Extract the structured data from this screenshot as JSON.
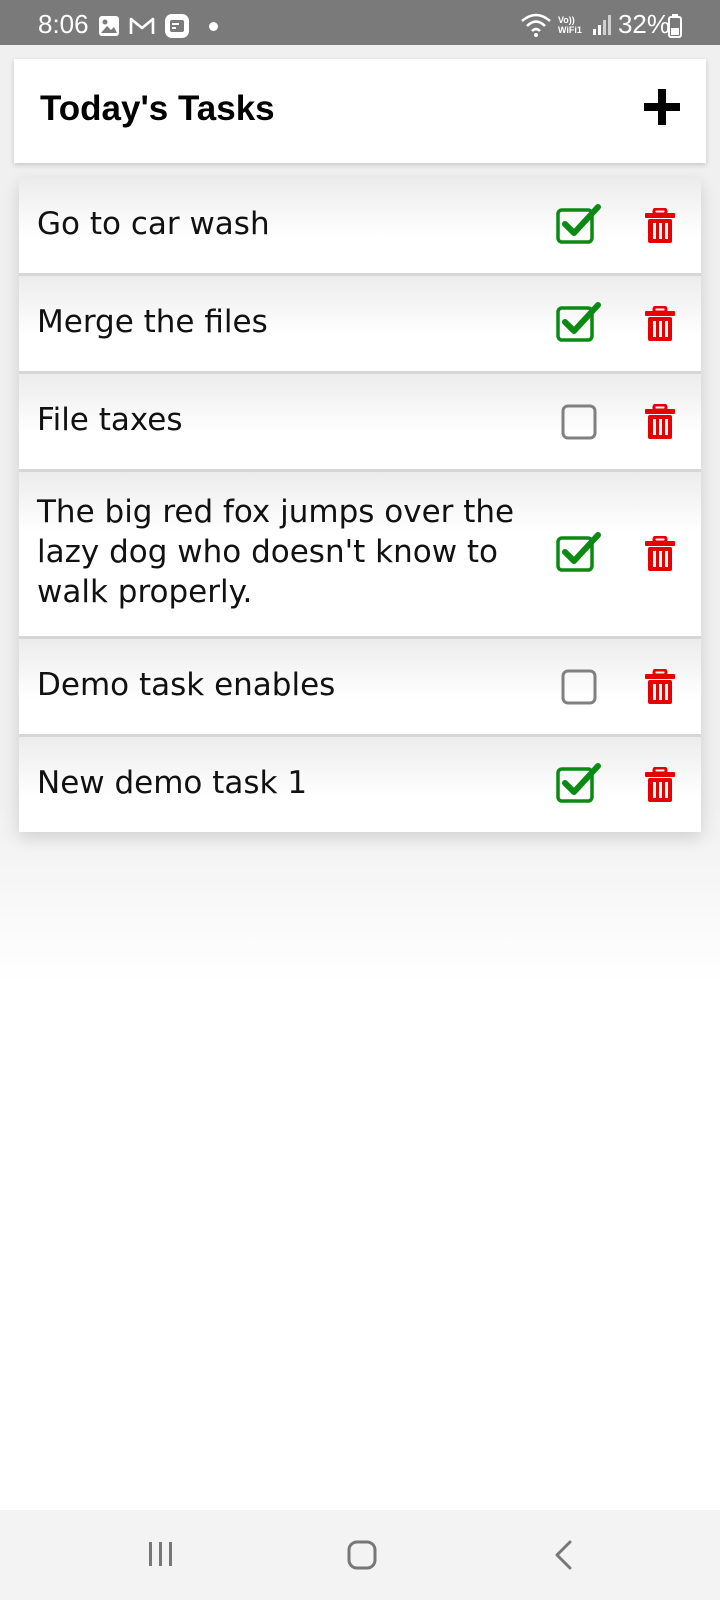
{
  "status_bar": {
    "time": "8:06",
    "battery": "32%",
    "network_label": "Vo)) WiFi1",
    "icons": [
      "gallery-icon",
      "gmail-icon",
      "app-notification-icon",
      "notification-dot-icon",
      "wifi-icon",
      "signal-icon",
      "battery-icon"
    ]
  },
  "header": {
    "title": "Today's Tasks",
    "add_icon": "plus-icon"
  },
  "tasks": [
    {
      "text": "Go to car wash",
      "completed": true
    },
    {
      "text": "Merge the files",
      "completed": true
    },
    {
      "text": "File taxes",
      "completed": false
    },
    {
      "text": "The big red fox jumps over the lazy dog who doesn't know to walk properly.",
      "completed": true
    },
    {
      "text": "Demo task enables",
      "completed": false
    },
    {
      "text": "New demo task 1",
      "completed": true
    }
  ],
  "colors": {
    "check_green": "#0a8a12",
    "unchecked_gray": "#808080",
    "delete_red": "#e60000",
    "status_bar": "#7a7a7a"
  },
  "nav_bar": {
    "buttons": [
      "recent-apps-icon",
      "home-icon",
      "back-icon"
    ]
  }
}
